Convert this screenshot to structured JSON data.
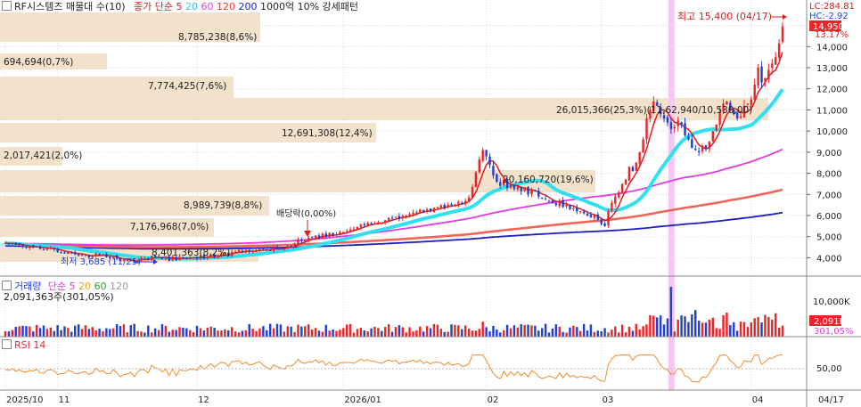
{
  "colors": {
    "up": "#e8262a",
    "down": "#1f3fcf",
    "ma5": "#e01b1b",
    "ma20": "#30e0ee",
    "ma60": "#e53ae0",
    "ma120": "#f0645a",
    "ma200": "#1a1fbf",
    "vp": "#f2e2cc",
    "highlight": "#f6c7f3",
    "rsi": "#f08a2a"
  },
  "price_panel": {
    "title": "RF시스템즈 매물대 수(10)",
    "legend": [
      {
        "label": "종가 단순 5",
        "color": "#e01b1b"
      },
      {
        "label": "20",
        "color": "#30c8e6"
      },
      {
        "label": "60",
        "color": "#e53ae0"
      },
      {
        "label": "120",
        "color": "#e53a3a"
      },
      {
        "label": "200",
        "color": "#1a1fbf"
      },
      {
        "label": "1000억 10% 강세패턴",
        "color": "#222222"
      }
    ],
    "high_label": "최고 15,400 (04/17)",
    "low_label": "최저 3,685 (11/25)",
    "dividend_label": "배당락(0,00%)",
    "lc": "LC:284.81",
    "hc": "HC:-2.92",
    "pct_label": "13.17%",
    "current_price": "14,950",
    "y_ticks": [
      "15,000",
      "14,000",
      "13,000",
      "12,000",
      "11,000",
      "10,000",
      "9,000",
      "8,000",
      "7,000",
      "6,000",
      "5,000",
      "4,000"
    ]
  },
  "volume_panel": {
    "title": "거래량",
    "legend": [
      {
        "label": "단순 5",
        "color": "#e53ae0"
      },
      {
        "label": "20",
        "color": "#e8a020"
      },
      {
        "label": "60",
        "color": "#2ea02e"
      },
      {
        "label": "120",
        "color": "#999999"
      }
    ],
    "info": "2,091,363주(301,05%)",
    "y_tick": "10,000K",
    "current": "2,091K",
    "current_pct": "301,05%"
  },
  "rsi_panel": {
    "title": "RSI 14",
    "y_tick": "50,00"
  },
  "x_axis": {
    "labels": [
      {
        "i": 0,
        "text": "2025/10"
      },
      {
        "i": 15,
        "text": "11"
      },
      {
        "i": 55,
        "text": "12"
      },
      {
        "i": 97,
        "text": "2026/01"
      },
      {
        "i": 138,
        "text": "02"
      },
      {
        "i": 171,
        "text": "03"
      },
      {
        "i": 214,
        "text": "04"
      }
    ],
    "right_label": "04/17"
  },
  "chart_data": {
    "type": "candlestick",
    "title": "RF시스템즈",
    "date_range": "2025/10 – 2026/04/17",
    "ylim": [
      3300,
      15700
    ],
    "highlight_index": 191,
    "closes": [
      4705,
      4638,
      4694,
      4609,
      4625,
      4534,
      4480,
      4560,
      4500,
      4535,
      4420,
      4391,
      4450,
      4484,
      4399,
      4278,
      4241,
      4203,
      4292,
      4242,
      4157,
      4106,
      4126,
      4155,
      4010,
      4050,
      4200,
      4120,
      4166,
      4026,
      3983,
      4080,
      3962,
      3842,
      3887,
      3907,
      3902,
      3760,
      3913,
      3992,
      3986,
      3887,
      4086,
      4028,
      4028,
      3949,
      4063,
      3859,
      4059,
      3865,
      4040,
      3983,
      3968,
      4005,
      4024,
      3953,
      4099,
      3964,
      4045,
      4122,
      3985,
      4116,
      4190,
      4225,
      4091,
      4275,
      4285,
      4365,
      4265,
      4360,
      4267,
      4288,
      4368,
      4440,
      4385,
      4354,
      4323,
      4521,
      4434,
      4430,
      4434,
      4583,
      4559,
      4662,
      4856,
      4789,
      4820,
      4951,
      4956,
      5050,
      4960,
      5134,
      4996,
      5169,
      5044,
      5104,
      5214,
      5222,
      5272,
      5338,
      5359,
      5456,
      5566,
      5533,
      5647,
      5608,
      5629,
      5673,
      5650,
      5784,
      5896,
      5873,
      5941,
      5847,
      5978,
      6000,
      6066,
      6128,
      6154,
      6282,
      6173,
      6287,
      6199,
      6364,
      6398,
      6479,
      6351,
      6513,
      6471,
      6518,
      6650,
      6579,
      6683,
      6850,
      7350,
      8050,
      8650,
      9100,
      8800,
      8400,
      7900,
      7600,
      7400,
      7700,
      7300,
      7450,
      7250,
      7400,
      7150,
      7300,
      7000,
      7250,
      7150,
      6900,
      6800,
      6750,
      6700,
      6600,
      6500,
      6700,
      6400,
      6550,
      6300,
      6350,
      6200,
      6200,
      6100,
      6000,
      5900,
      6000,
      5800,
      5600,
      5500,
      6200,
      6600,
      6900,
      7100,
      7500,
      7700,
      8300,
      8100,
      8500,
      9000,
      9600,
      10600,
      11000,
      11400,
      11200,
      10800,
      10600,
      10400,
      10100,
      10200,
      10500,
      10300,
      9800,
      9600,
      9200,
      9100,
      9000,
      9300,
      9200,
      9500,
      10000,
      10300,
      10900,
      11300,
      11400,
      11000,
      10800,
      10600,
      10700,
      11200,
      11300,
      11500,
      12200,
      13000,
      12300,
      12500,
      12900,
      13200,
      13500,
      14150,
      14950
    ]
  }
}
